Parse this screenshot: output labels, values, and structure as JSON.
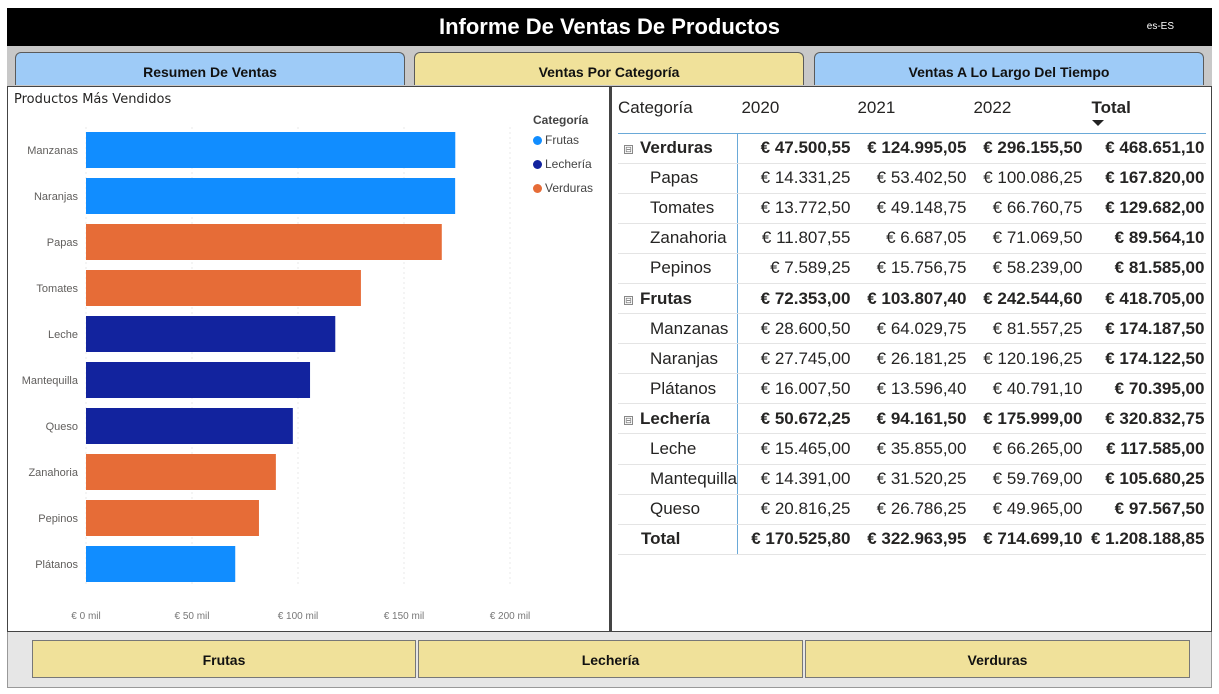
{
  "header": {
    "title": "Informe De Ventas De Productos",
    "locale": "es-ES",
    "background": "#000000"
  },
  "tabs": [
    {
      "label": "Resumen De Ventas",
      "color": "#9ecbf7",
      "active": false
    },
    {
      "label": "Ventas Por Categoría",
      "color": "#f0e19a",
      "active": true
    },
    {
      "label": "Ventas A Lo Largo Del Tiempo",
      "color": "#9ecbf7",
      "active": false
    }
  ],
  "chart_data": {
    "type": "bar",
    "orientation": "horizontal",
    "title": "Productos Más Vendidos",
    "categories": [
      "Manzanas",
      "Naranjas",
      "Papas",
      "Tomates",
      "Leche",
      "Mantequilla",
      "Queso",
      "Zanahoria",
      "Pepinos",
      "Plátanos"
    ],
    "values": [
      174187.5,
      174122.5,
      167820.0,
      129682.0,
      117585.0,
      105680.25,
      97567.5,
      89564.1,
      81585.0,
      70395.0
    ],
    "series_of_category": [
      "Frutas",
      "Frutas",
      "Verduras",
      "Verduras",
      "Lechería",
      "Lechería",
      "Lechería",
      "Verduras",
      "Verduras",
      "Frutas"
    ],
    "legend": {
      "title": "Categoría",
      "placement": "top-right",
      "items": [
        {
          "name": "Frutas",
          "color": "#118dff"
        },
        {
          "name": "Lechería",
          "color": "#12239e"
        },
        {
          "name": "Verduras",
          "color": "#e66c37"
        }
      ]
    },
    "x_ticks": [
      0,
      50000,
      100000,
      150000,
      200000
    ],
    "x_tick_labels": [
      "€ 0 mil",
      "€ 50 mil",
      "€ 100 mil",
      "€ 150 mil",
      "€ 200 mil"
    ],
    "xlim": [
      0,
      200000
    ],
    "grid": true
  },
  "matrix": {
    "headers": [
      "Categoría",
      "2020",
      "2021",
      "2022",
      "Total"
    ],
    "sorted_column": "Total",
    "groups": [
      {
        "name": "Verduras",
        "values": [
          "€ 47.500,55",
          "€ 124.995,05",
          "€ 296.155,50",
          "€ 468.651,10"
        ],
        "rows": [
          {
            "name": "Papas",
            "values": [
              "€ 14.331,25",
              "€ 53.402,50",
              "€ 100.086,25",
              "€ 167.820,00"
            ]
          },
          {
            "name": "Tomates",
            "values": [
              "€ 13.772,50",
              "€ 49.148,75",
              "€ 66.760,75",
              "€ 129.682,00"
            ]
          },
          {
            "name": "Zanahoria",
            "values": [
              "€ 11.807,55",
              "€ 6.687,05",
              "€ 71.069,50",
              "€ 89.564,10"
            ]
          },
          {
            "name": "Pepinos",
            "values": [
              "€ 7.589,25",
              "€ 15.756,75",
              "€ 58.239,00",
              "€ 81.585,00"
            ]
          }
        ]
      },
      {
        "name": "Frutas",
        "values": [
          "€ 72.353,00",
          "€ 103.807,40",
          "€ 242.544,60",
          "€ 418.705,00"
        ],
        "rows": [
          {
            "name": "Manzanas",
            "values": [
              "€ 28.600,50",
              "€ 64.029,75",
              "€ 81.557,25",
              "€ 174.187,50"
            ]
          },
          {
            "name": "Naranjas",
            "values": [
              "€ 27.745,00",
              "€ 26.181,25",
              "€ 120.196,25",
              "€ 174.122,50"
            ]
          },
          {
            "name": "Plátanos",
            "values": [
              "€ 16.007,50",
              "€ 13.596,40",
              "€ 40.791,10",
              "€ 70.395,00"
            ]
          }
        ]
      },
      {
        "name": "Lechería",
        "values": [
          "€ 50.672,25",
          "€ 94.161,50",
          "€ 175.999,00",
          "€ 320.832,75"
        ],
        "rows": [
          {
            "name": "Leche",
            "values": [
              "€ 15.465,00",
              "€ 35.855,00",
              "€ 66.265,00",
              "€ 117.585,00"
            ]
          },
          {
            "name": "Mantequilla",
            "values": [
              "€ 14.391,00",
              "€ 31.520,25",
              "€ 59.769,00",
              "€ 105.680,25"
            ]
          },
          {
            "name": "Queso",
            "values": [
              "€ 20.816,25",
              "€ 26.786,25",
              "€ 49.965,00",
              "€ 97.567,50"
            ]
          }
        ]
      }
    ],
    "total": {
      "name": "Total",
      "values": [
        "€ 170.525,80",
        "€ 322.963,95",
        "€ 714.699,10",
        "€ 1.208.188,85"
      ]
    },
    "expander_glyph": "⊟"
  },
  "filters": [
    {
      "label": "Frutas"
    },
    {
      "label": "Lechería"
    },
    {
      "label": "Verduras"
    }
  ],
  "colors": {
    "tab_blue": "#9ecbf7",
    "tab_yellow": "#f0e19a",
    "accent_line": "#6aa9d8"
  }
}
